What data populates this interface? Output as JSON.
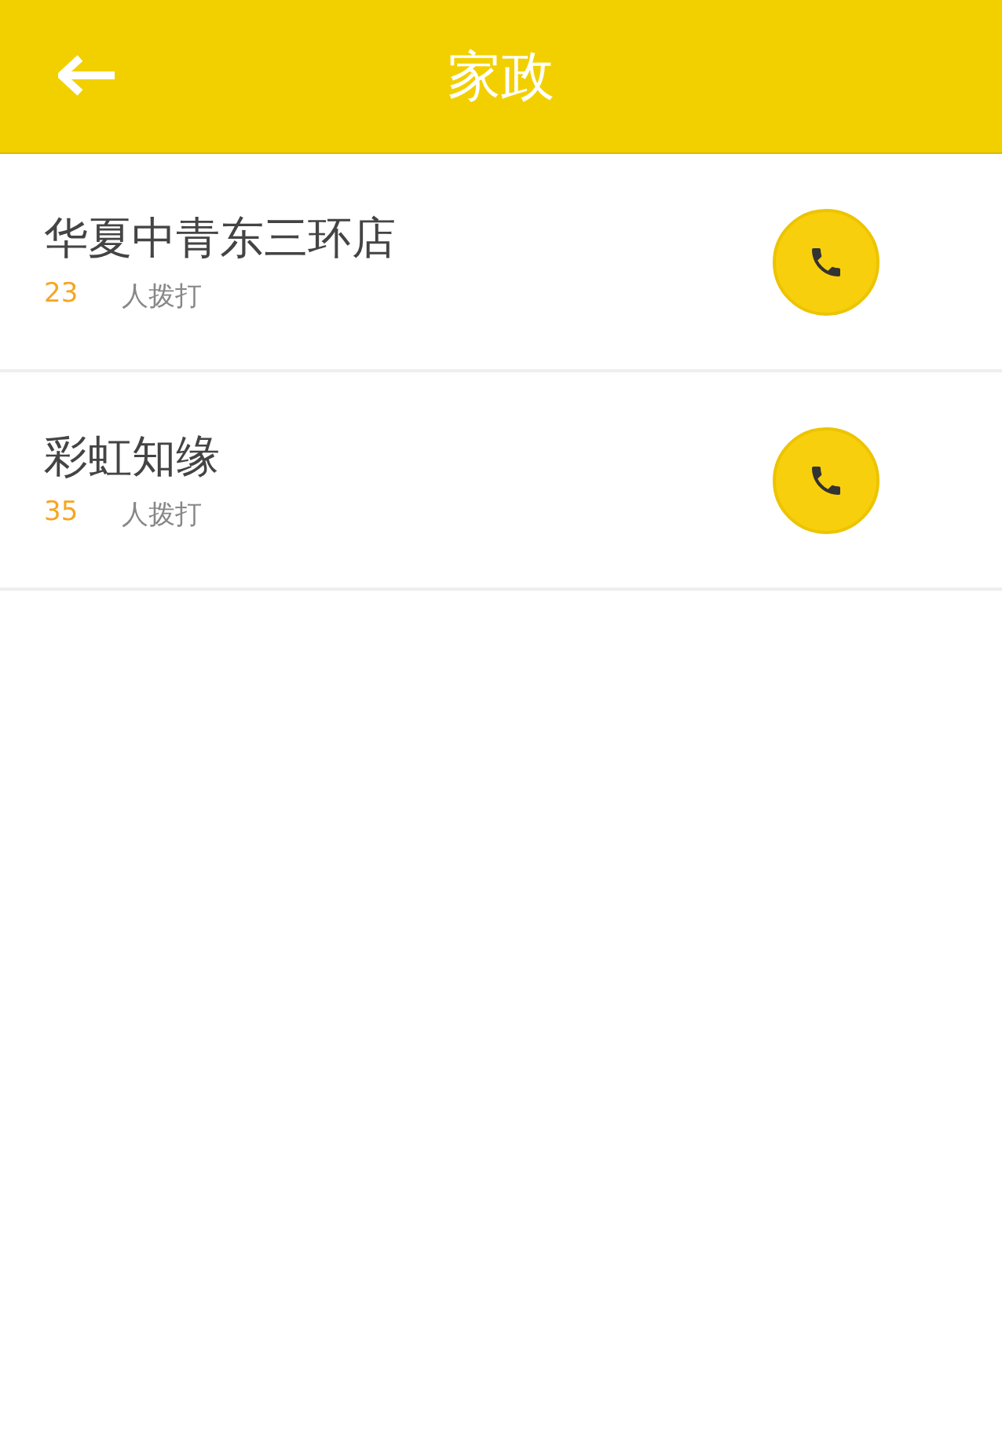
{
  "header": {
    "title": "家政"
  },
  "items": [
    {
      "name": "华夏中青东三环店",
      "count": "23",
      "count_label": "人拨打"
    },
    {
      "name": "彩虹知缘",
      "count": "35",
      "count_label": "人拨打"
    }
  ]
}
